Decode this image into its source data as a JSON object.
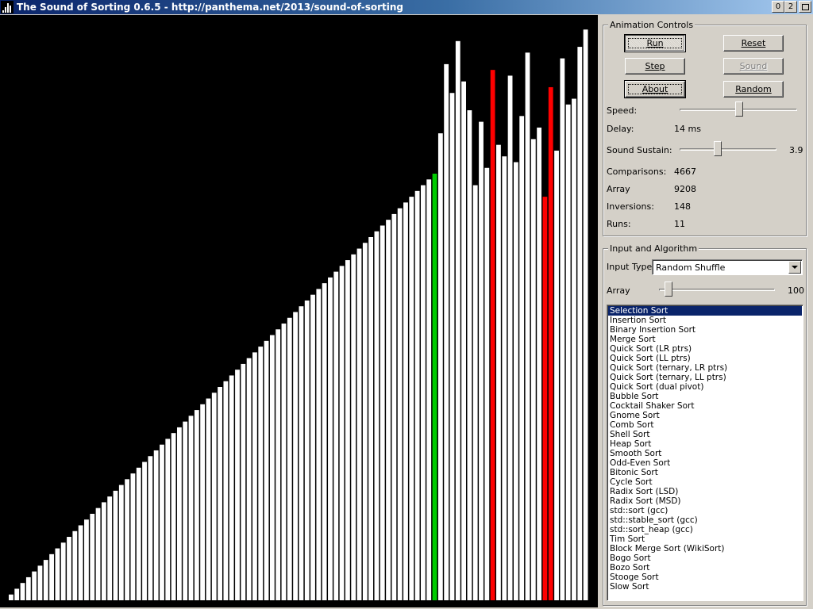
{
  "window": {
    "title": "The Sound of Sorting 0.6.5 - http://panthema.net/2013/sound-of-sorting",
    "buttons": {
      "minimize": "0",
      "maximize": "2"
    }
  },
  "colors": {
    "background": "#000000",
    "bar_default": "#ffffff",
    "bar_compare": "#ff0000",
    "bar_access": "#00cc00",
    "selection": "#0a246a"
  },
  "animation_controls": {
    "title": "Animation Controls",
    "buttons": {
      "run": "Run",
      "reset": "Reset",
      "step": "Step",
      "sound": "Sound",
      "about": "About",
      "random": "Random"
    },
    "speed_label": "Speed:",
    "speed_position": 0.51,
    "delay_label": "Delay:",
    "delay_value": "14 ms",
    "sustain_label": "Sound Sustain:",
    "sustain_value": "3.9",
    "sustain_position": 0.39,
    "stats": [
      {
        "label": "Comparisons:",
        "value": "4667"
      },
      {
        "label": "Array",
        "value": "9208"
      },
      {
        "label": "Inversions:",
        "value": "148"
      },
      {
        "label": "Runs:",
        "value": "11"
      }
    ]
  },
  "input_algorithm": {
    "title": "Input and Algorithm",
    "input_type_label": "Input Type:",
    "input_type_value": "Random Shuffle",
    "array_label": "Array",
    "array_value": "100",
    "array_position": 0.08,
    "algorithms": [
      "Selection Sort",
      "Insertion Sort",
      "Binary Insertion Sort",
      "Merge Sort",
      "Quick Sort (LR ptrs)",
      "Quick Sort (LL ptrs)",
      "Quick Sort (ternary, LR ptrs)",
      "Quick Sort (ternary, LL ptrs)",
      "Quick Sort (dual pivot)",
      "Bubble Sort",
      "Cocktail Shaker Sort",
      "Gnome Sort",
      "Comb Sort",
      "Shell Sort",
      "Heap Sort",
      "Smooth Sort",
      "Odd-Even Sort",
      "Bitonic Sort",
      "Cycle Sort",
      "Radix Sort (LSD)",
      "Radix Sort (MSD)",
      "std::sort (gcc)",
      "std::stable_sort (gcc)",
      "std::sort_heap (gcc)",
      "Tim Sort",
      "Block Merge Sort (WikiSort)",
      "Bogo Sort",
      "Bozo Sort",
      "Stooge Sort",
      "Slow Sort"
    ],
    "selected_index": 0
  },
  "array_bars": {
    "max": 100,
    "values": [
      1,
      2,
      3,
      4,
      5,
      6,
      7,
      8,
      9,
      10,
      11,
      12,
      13,
      14,
      15,
      16,
      17,
      18,
      19,
      20,
      21,
      22,
      23,
      24,
      25,
      26,
      27,
      28,
      29,
      30,
      31,
      32,
      33,
      34,
      35,
      36,
      37,
      38,
      39,
      40,
      41,
      42,
      43,
      44,
      45,
      46,
      47,
      48,
      49,
      50,
      51,
      52,
      53,
      54,
      55,
      56,
      57,
      58,
      59,
      60,
      61,
      62,
      63,
      64,
      65,
      66,
      67,
      68,
      69,
      70,
      71,
      72,
      73,
      74,
      81,
      93,
      88,
      97,
      90,
      85,
      72,
      83,
      75,
      92,
      79,
      77,
      91,
      76,
      84,
      95,
      80,
      82,
      70,
      89,
      78,
      94,
      86,
      87,
      96,
      99
    ],
    "highlights": [
      {
        "index": 73,
        "color": "#00cc00"
      },
      {
        "index": 83,
        "color": "#ff0000"
      },
      {
        "index": 92,
        "color": "#ff0000"
      },
      {
        "index": 93,
        "color": "#ff0000"
      }
    ]
  }
}
